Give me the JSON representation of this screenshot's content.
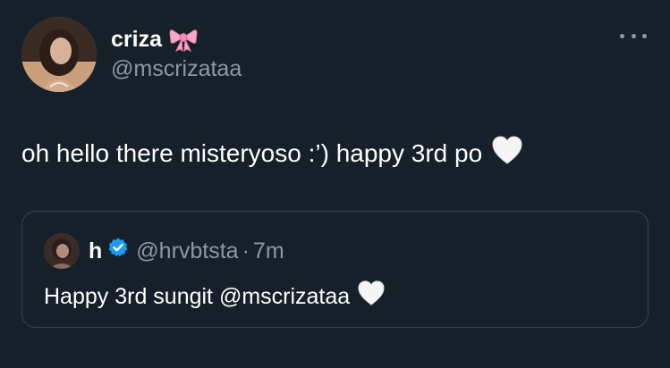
{
  "author": {
    "name": "criza",
    "name_emoji_icon": "ribbon-bow-icon",
    "handle": "@mscrizataa",
    "avatar_icon": "profile-avatar"
  },
  "tweet": {
    "text": "oh hello there misteryoso :’) happy 3rd po",
    "emoji_icon": "white-heart-icon"
  },
  "quoted_tweet": {
    "name": "h",
    "verified_icon": "verified-badge-icon",
    "handle": "@hrvbtsta",
    "separator": "·",
    "time": "7m",
    "text": "Happy 3rd sungit @mscrizataa",
    "emoji_icon": "white-heart-icon"
  },
  "more_menu_icon": "more-options-icon",
  "colors": {
    "background": "#15202b",
    "text_primary": "#ffffff",
    "text_secondary": "#8b98a5",
    "border": "#38444d",
    "verified_blue": "#1d9bf0",
    "bow_pink": "#f7a8c4"
  }
}
